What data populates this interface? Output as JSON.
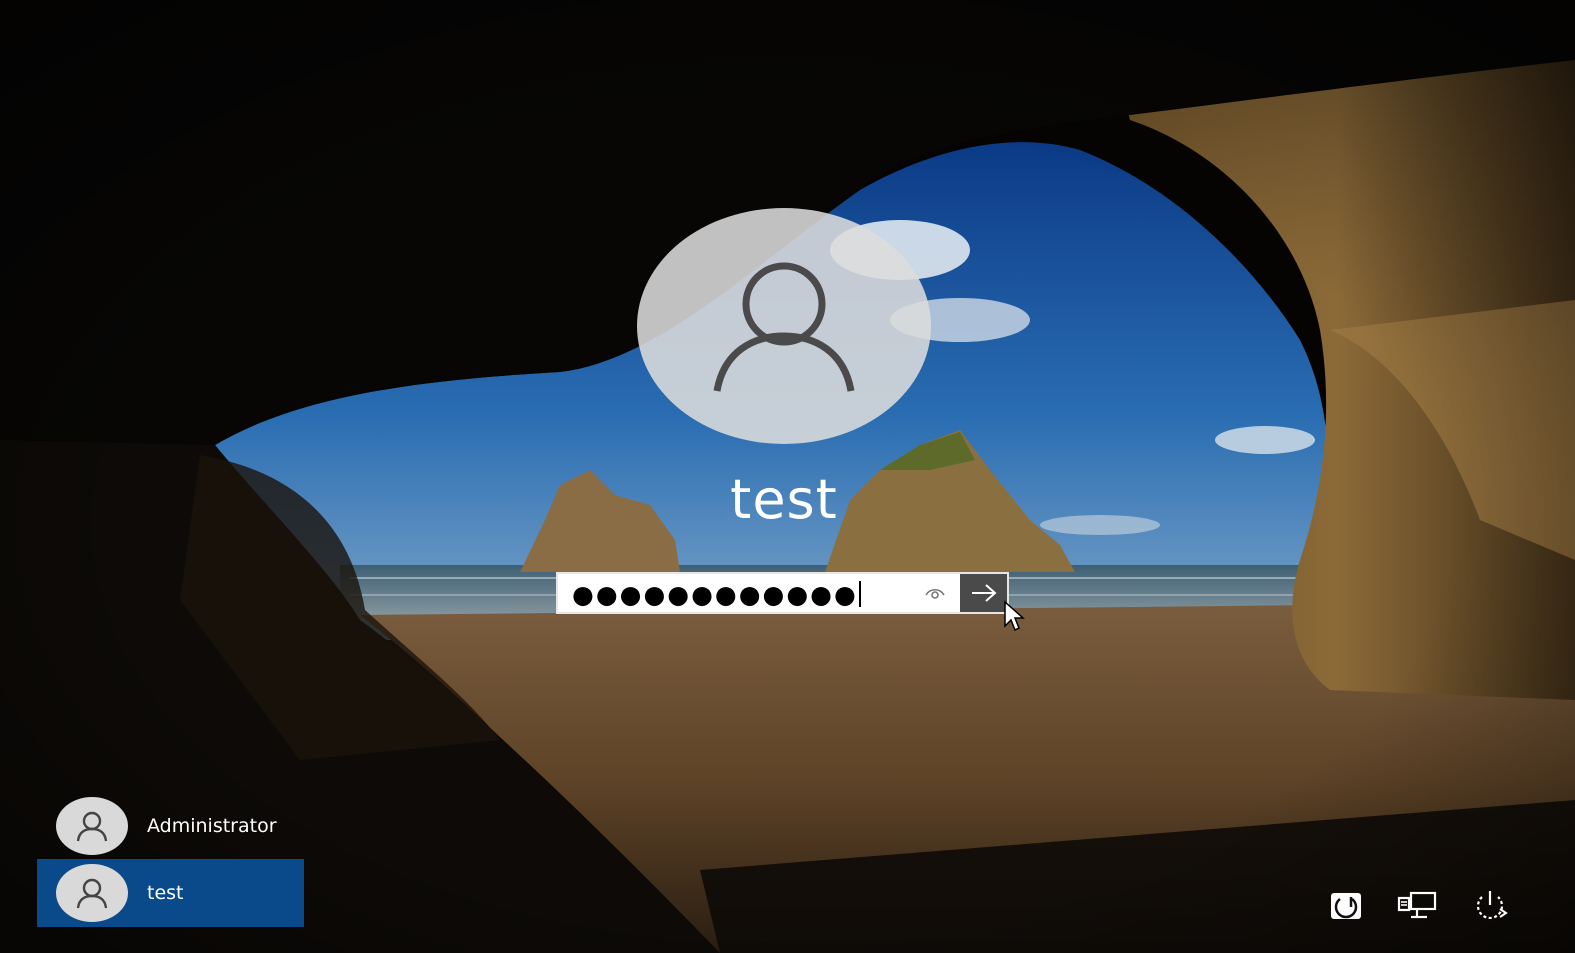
{
  "login": {
    "username": "test",
    "password_mask": "●●●●●●●●●●●●",
    "reveal_icon": "eye-icon",
    "submit_icon": "arrow-right-icon"
  },
  "users": [
    {
      "name": "Administrator",
      "icon": "user-icon"
    },
    {
      "name": "test",
      "icon": "user-icon",
      "selected": true
    }
  ],
  "tray": {
    "icons": [
      "ease-of-access-icon",
      "network-icon",
      "power-icon"
    ]
  },
  "colors": {
    "selected_user_bg": "#0a4a8a",
    "avatar_bg": "#dcdcdc",
    "submit_bg": "#4a4a4a"
  }
}
